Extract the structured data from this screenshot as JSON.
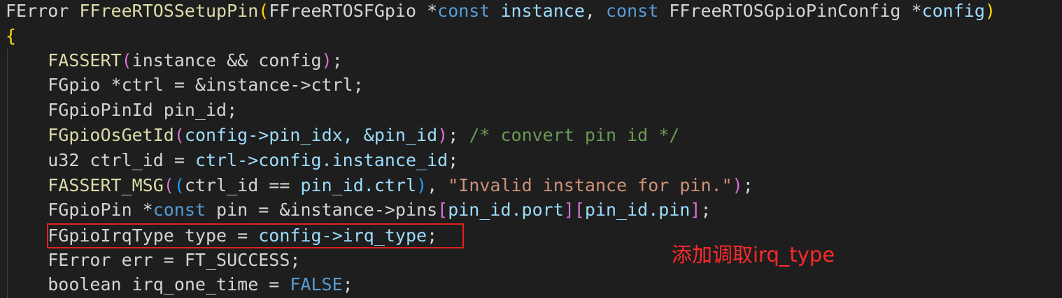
{
  "code": {
    "l1": {
      "ret": "FError",
      "fname": "FFreeRTOSSetupPin",
      "lp": "(",
      "t1": "FFreeRTOSFGpio",
      "s1": " *",
      "c1": "const",
      "p1": "instance",
      "comma": ", ",
      "c2": "const",
      "t2": "FFreeRTOSGpioPinConfig",
      "s2": " *",
      "p2": "config",
      "rp": ")"
    },
    "l2": {
      "brace": "{"
    },
    "l3": {
      "fn": "FASSERT",
      "lp": "(",
      "a": "instance && config",
      "rp": ")",
      "end": ";"
    },
    "l4": {
      "t": "FGpio *ctrl = &instance->ctrl;"
    },
    "l5": {
      "t": "FGpioPinId pin_id;"
    },
    "l6": {
      "fn": "FGpioOsGetId",
      "lp": "(",
      "a": "config->pin_idx, &pin_id",
      "rp": ")",
      "end": "; ",
      "cmt": "/* convert pin id */"
    },
    "l7": {
      "a": "u32 ctrl_id = ",
      "b": "ctrl->config.instance_id",
      "end": ";"
    },
    "l8": {
      "fn": "FASSERT_MSG",
      "lp": "(",
      "lp2": "(",
      "a": "ctrl_id == ",
      "b": "pin_id.ctrl",
      "rp2": ")",
      "comma": ", ",
      "str": "\"Invalid instance for pin.\"",
      "rp": ")",
      "end": ";"
    },
    "l9": {
      "a": "FGpioPin *",
      "kw": "const",
      "b": " pin = &instance->pins",
      "lb1": "[",
      "i1": "pin_id.port",
      "rb1": "]",
      "lb2": "[",
      "i2": "pin_id.pin",
      "rb2": "]",
      "end": ";"
    },
    "l10": {
      "a": "FGpioIrqType type = ",
      "b": "config->irq_type",
      "end": ";"
    },
    "l11": {
      "t": "FError err = FT_SUCCESS;"
    },
    "l12": {
      "a": "boolean irq_one_time = ",
      "kw": "FALSE",
      "end": ";"
    }
  },
  "annotation": "添加调取irq_type",
  "colors": {
    "highlight": "#e02020",
    "annotation": "#ff2a2a"
  }
}
